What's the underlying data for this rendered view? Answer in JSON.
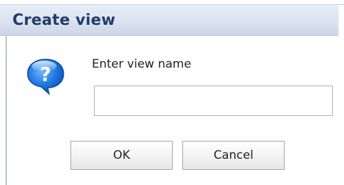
{
  "dialog": {
    "title": "Create view",
    "prompt": "Enter view name",
    "input": {
      "value": "",
      "placeholder": ""
    },
    "buttons": {
      "ok_label": "OK",
      "cancel_label": "Cancel"
    },
    "icon": "help-question-icon",
    "colors": {
      "title_text": "#1f3d6b",
      "titlebar": "#dae3ef",
      "icon_blue": "#1a6fd1"
    }
  }
}
